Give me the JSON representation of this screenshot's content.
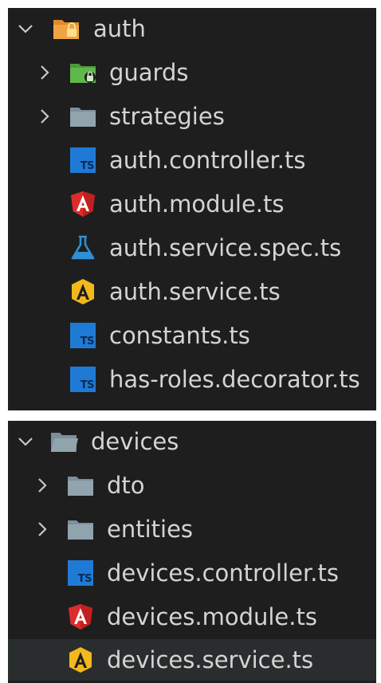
{
  "panels": [
    {
      "folder": {
        "label": "auth",
        "expanded": true,
        "icon": "folder-lock-open-icon"
      },
      "children": [
        {
          "label": "guards",
          "type": "folder",
          "icon": "folder-guard-icon"
        },
        {
          "label": "strategies",
          "type": "folder",
          "icon": "folder-icon"
        },
        {
          "label": "auth.controller.ts",
          "type": "file",
          "icon": "typescript-icon"
        },
        {
          "label": "auth.module.ts",
          "type": "file",
          "icon": "angular-icon"
        },
        {
          "label": "auth.service.spec.ts",
          "type": "file",
          "icon": "test-flask-icon"
        },
        {
          "label": "auth.service.ts",
          "type": "file",
          "icon": "angular-service-icon"
        },
        {
          "label": "constants.ts",
          "type": "file",
          "icon": "typescript-icon"
        },
        {
          "label": "has-roles.decorator.ts",
          "type": "file",
          "icon": "typescript-icon"
        }
      ]
    },
    {
      "folder": {
        "label": "devices",
        "expanded": true,
        "icon": "folder-open-icon"
      },
      "children": [
        {
          "label": "dto",
          "type": "folder",
          "icon": "folder-icon"
        },
        {
          "label": "entities",
          "type": "folder",
          "icon": "folder-icon"
        },
        {
          "label": "devices.controller.ts",
          "type": "file",
          "icon": "typescript-icon"
        },
        {
          "label": "devices.module.ts",
          "type": "file",
          "icon": "angular-icon"
        },
        {
          "label": "devices.service.ts",
          "type": "file",
          "icon": "angular-service-icon",
          "selected": true
        }
      ]
    }
  ],
  "ts_badge_text": "TS",
  "colors": {
    "background": "#1e1e1e",
    "text": "#d4d4d4",
    "typescript": "#1f7ad6",
    "angular": "#dd2c2c",
    "angular_service": "#f2b81c",
    "folder": "#90a4ae",
    "folder_orange": "#f0a544",
    "folder_green": "#5fb84c",
    "flask": "#2f8fd6",
    "selected_row": "#2a2d2e"
  }
}
